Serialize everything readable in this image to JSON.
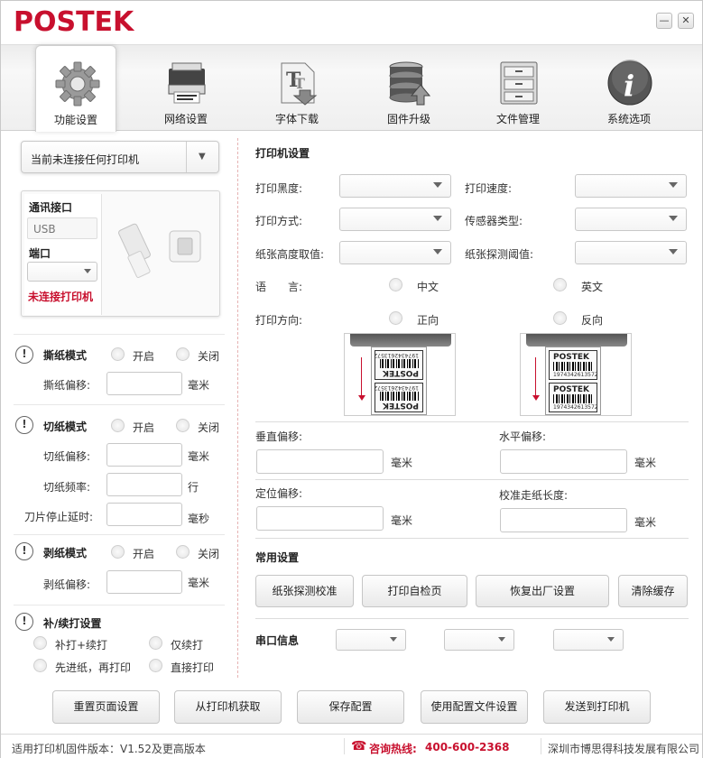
{
  "app": {
    "logo": "POSTEK",
    "minimize": "—",
    "close": "✕"
  },
  "toolbar": {
    "items": [
      {
        "label": "功能设置",
        "icon": "gear-icon"
      },
      {
        "label": "网络设置",
        "icon": "printer-network-icon"
      },
      {
        "label": "字体下载",
        "icon": "font-download-icon"
      },
      {
        "label": "固件升级",
        "icon": "firmware-upgrade-icon"
      },
      {
        "label": "文件管理",
        "icon": "file-cabinet-icon"
      },
      {
        "label": "系统选项",
        "icon": "info-icon"
      }
    ]
  },
  "left": {
    "connection": "当前未连接任何打印机",
    "comm_label": "通讯接口",
    "comm_value": "USB",
    "port_label": "端口",
    "port_value": "",
    "status": "未连接打印机",
    "tear": {
      "title": "撕纸模式",
      "on": "开启",
      "off": "关闭",
      "offset_label": "撕纸偏移:",
      "unit": "毫米"
    },
    "cut": {
      "title": "切纸模式",
      "on": "开启",
      "off": "关闭",
      "offset_label": "切纸偏移:",
      "offset_unit": "毫米",
      "freq_label": "切纸频率:",
      "freq_unit": "行",
      "delay_label": "刀片停止延时:",
      "delay_unit": "毫秒"
    },
    "peel": {
      "title": "剥纸模式",
      "on": "开启",
      "off": "关闭",
      "offset_label": "剥纸偏移:",
      "unit": "毫米"
    },
    "reprint": {
      "title": "补/续打设置",
      "opt1": "补打+续打",
      "opt2": "仅续打",
      "opt3": "先进纸，再打印",
      "opt4": "直接打印"
    }
  },
  "right": {
    "printer_settings_title": "打印机设置",
    "darkness_label": "打印黑度:",
    "speed_label": "打印速度:",
    "method_label": "打印方式:",
    "sensor_label": "传感器类型:",
    "height_label": "纸张高度取值:",
    "threshold_label": "纸张探测阈值:",
    "language_label": "语　　言:",
    "lang_cn": "中文",
    "lang_en": "英文",
    "direction_label": "打印方向:",
    "dir_forward": "正向",
    "dir_reverse": "反向",
    "label_brand": "POSTEK",
    "label_code": "1974342613572",
    "v_offset_label": "垂直偏移:",
    "h_offset_label": "水平偏移:",
    "pos_offset_label": "定位偏移:",
    "calib_len_label": "校准走纸长度:",
    "unit": "毫米",
    "common_title": "常用设置",
    "btn_detect": "纸张探测校准",
    "btn_selftest": "打印自检页",
    "btn_factory": "恢复出厂设置",
    "btn_clear": "清除缓存",
    "serial_label": "串口信息"
  },
  "bottom": {
    "reset": "重置页面设置",
    "fetch": "从打印机获取",
    "save": "保存配置",
    "use_file": "使用配置文件设置",
    "send": "发送到打印机"
  },
  "status": {
    "firmware": "适用打印机固件版本：V1.52及更高版本",
    "hotline_label": "咨询热线:",
    "hotline": "400-600-2368",
    "company": "深圳市博思得科技发展有限公司"
  }
}
